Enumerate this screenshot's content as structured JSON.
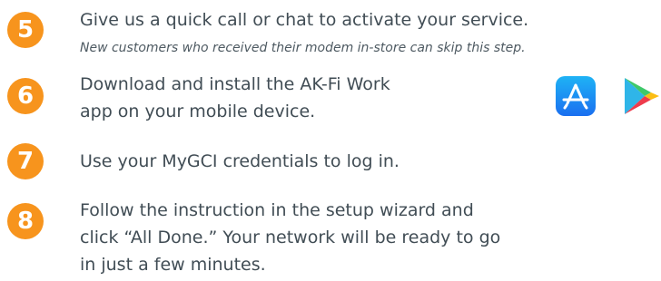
{
  "colors": {
    "badge": "#f7941d",
    "text": "#414d55",
    "app_store_blue": "#1a8cf0"
  },
  "steps": [
    {
      "number": "5",
      "text": "Give us a quick call or chat to activate your service.",
      "note": "New customers who received their modem in-store can skip this step."
    },
    {
      "number": "6",
      "line1": "Download and install the AK-Fi Work",
      "line2": "app on your mobile device."
    },
    {
      "number": "7",
      "text": "Use your MyGCI credentials to log in."
    },
    {
      "number": "8",
      "line1": "Follow the instruction in the setup wizard and",
      "line2": "click “All Done.” Your network will be ready to go",
      "line3": "in just a few minutes."
    }
  ],
  "icons": {
    "app_store": "app-store-icon",
    "google_play": "google-play-icon"
  }
}
